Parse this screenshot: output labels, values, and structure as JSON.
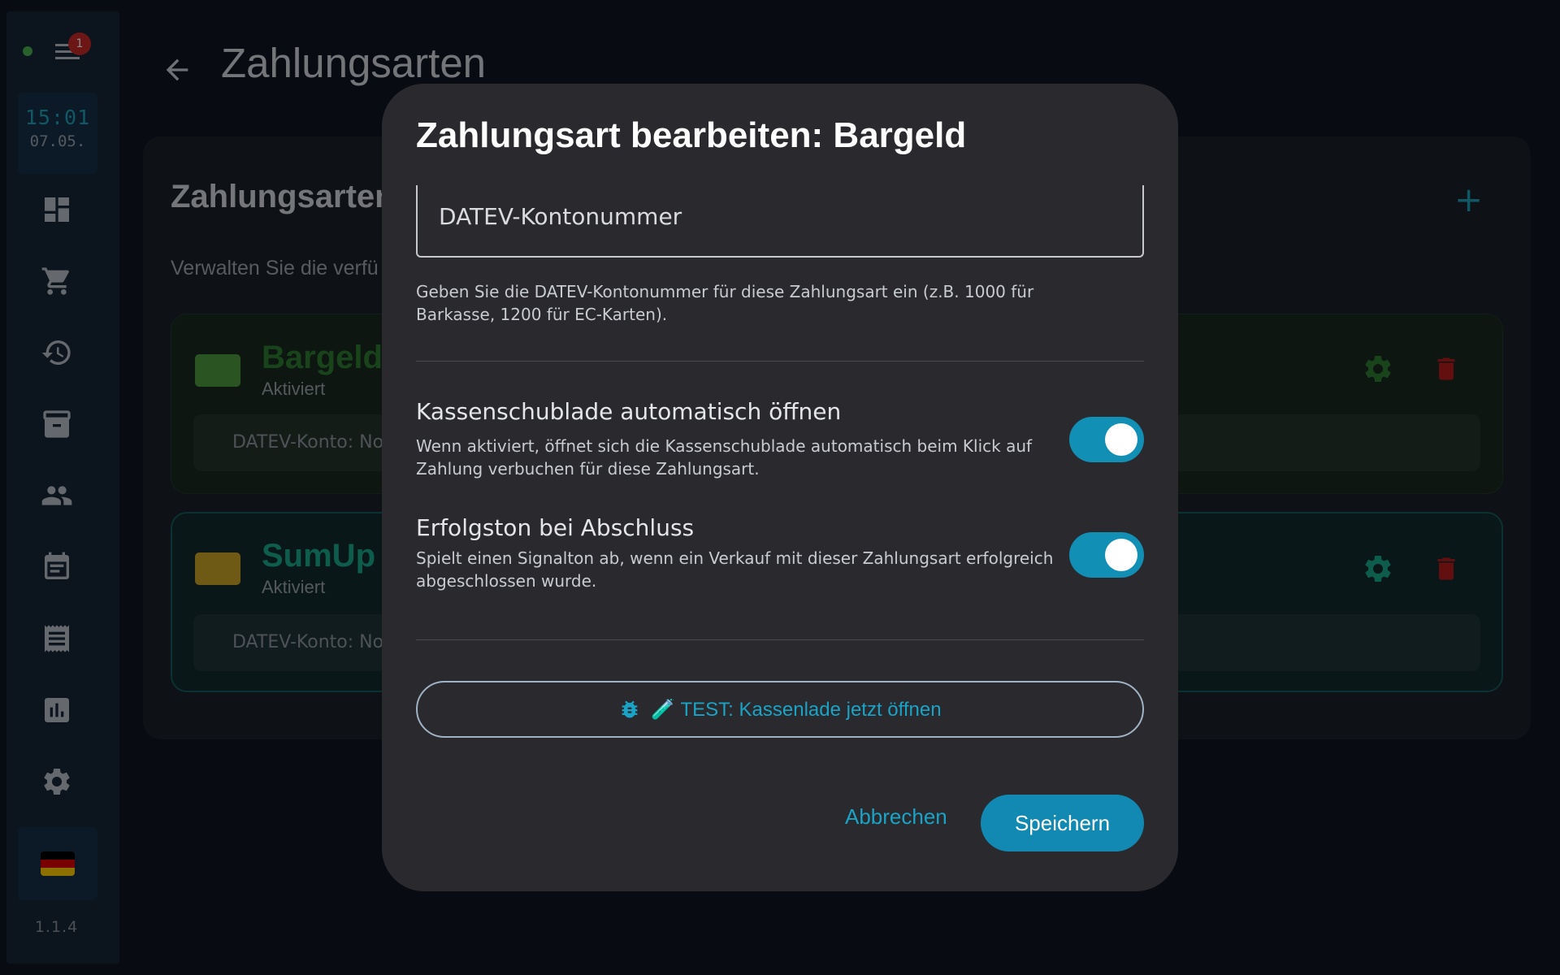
{
  "sidebar": {
    "badge_count": "1",
    "time": "15:01",
    "date": "07.05.",
    "version": "1.1.4",
    "nav_icons": [
      "dashboard-icon",
      "cart-icon",
      "history-icon",
      "archive-icon",
      "people-icon",
      "calendar-icon",
      "receipt-icon",
      "reports-icon",
      "settings-icon"
    ]
  },
  "header": {
    "title": "Zahlungsarten"
  },
  "card": {
    "title": "Zahlungsarten",
    "description": "Verwalten Sie die verfü",
    "methods": [
      {
        "name": "Bargeld",
        "status": "Aktiviert",
        "datev": "DATEV-Konto: No",
        "color": "#2e7d32"
      },
      {
        "name": "SumUp",
        "status": "Aktiviert",
        "datev": "DATEV-Konto: No",
        "color": "#1aa88a"
      }
    ]
  },
  "dialog": {
    "title": "Zahlungsart bearbeiten: Bargeld",
    "field_label": "DATEV-Kontonummer",
    "field_helper": "Geben Sie die DATEV-Kontonummer für diese Zahlungsart ein (z.B. 1000 für Barkasse, 1200 für EC-Karten).",
    "options": [
      {
        "title": "Kassenschublade automatisch öffnen",
        "description": "Wenn aktiviert, öffnet sich die Kassenschublade automatisch beim Klick auf Zahlung verbuchen für diese Zahlungsart.",
        "enabled": true
      },
      {
        "title": "Erfolgston bei Abschluss",
        "description": "Spielt einen Signalton ab, wenn ein Verkauf mit dieser Zahlungsart erfolgreich abgeschlossen wurde.",
        "enabled": true
      }
    ],
    "test_button": "🧪 TEST: Kassenlade jetzt öffnen",
    "cancel": "Abbrechen",
    "save": "Speichern"
  },
  "colors": {
    "accent": "#1189b2",
    "dialog_bg": "#29292e",
    "app_bg": "#0f141f"
  }
}
